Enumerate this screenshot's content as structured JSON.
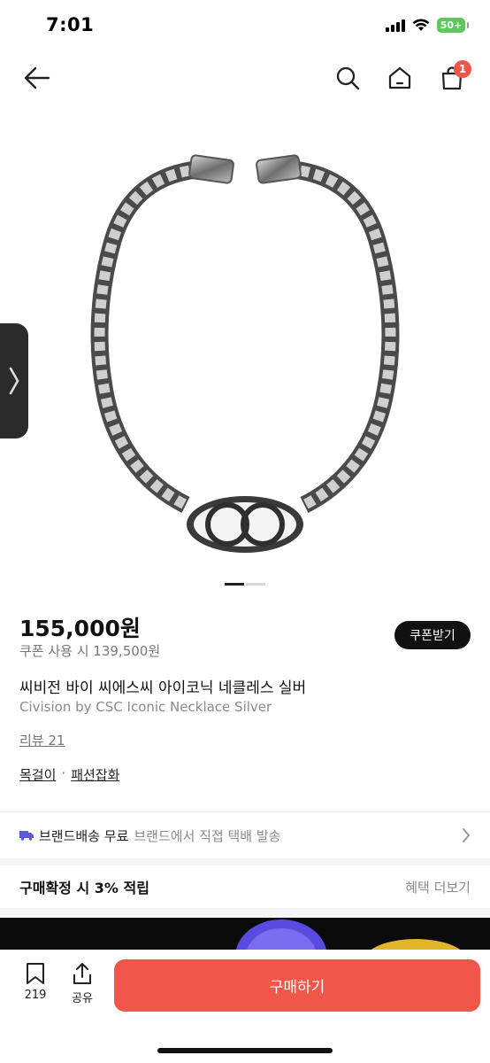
{
  "status_bar": {
    "time": "7:01",
    "battery": "50+"
  },
  "nav": {
    "cart_count": "1",
    "icons": [
      "back-arrow-icon",
      "search-icon",
      "home-icon",
      "shopping-bag-icon"
    ]
  },
  "product": {
    "price": "155,000원",
    "coupon_price": "쿠폰 사용 시 139,500원",
    "coupon_button": "쿠폰받기",
    "name_ko": "씨비전 바이 씨에스씨 아이코닉 네클레스 실버",
    "name_en": "Civision by CSC Iconic Necklace Silver",
    "review": "리뷰 21",
    "category_main": "목걸이",
    "category_sep": "·",
    "category_sub": "패션잡화"
  },
  "shipping": {
    "main": "브랜드배송 무료",
    "sub": "브랜드에서 직접 택배 발송"
  },
  "points": {
    "title": "구매확정 시 3% 적립",
    "more": "혜택 더보기"
  },
  "bottom_bar": {
    "bookmark_count": "219",
    "share_label": "공유",
    "buy_label": "구매하기"
  },
  "colors": {
    "accent": "#f0564a",
    "badge": "#f0554a",
    "dark": "#111111"
  }
}
